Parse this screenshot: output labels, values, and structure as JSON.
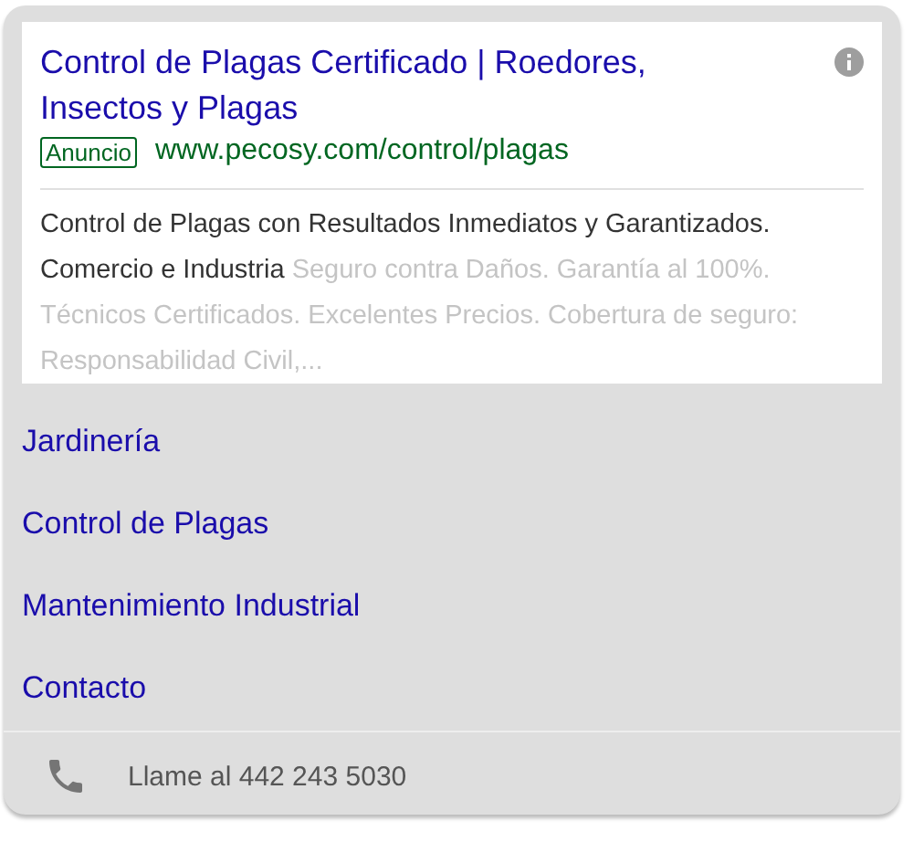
{
  "ad": {
    "title": "Control de Plagas Certificado | Roedores, Insectos y Plagas",
    "badge": "Anuncio",
    "url": "www.pecosy.com/control/plagas",
    "description": "Control de Plagas con Resultados Inmediatos y Garantizados. Comercio e Industria",
    "description_faded": "Seguro contra Daños. Garantía al 100%. Técnicos Certificados. Excelentes Precios. Cobertura de seguro: Responsabilidad Civil,..."
  },
  "sitelinks": [
    "Jardinería",
    "Control de Plagas",
    "Mantenimiento Industrial",
    "Contacto"
  ],
  "call": {
    "label": "Llame al 442 243 5030"
  }
}
